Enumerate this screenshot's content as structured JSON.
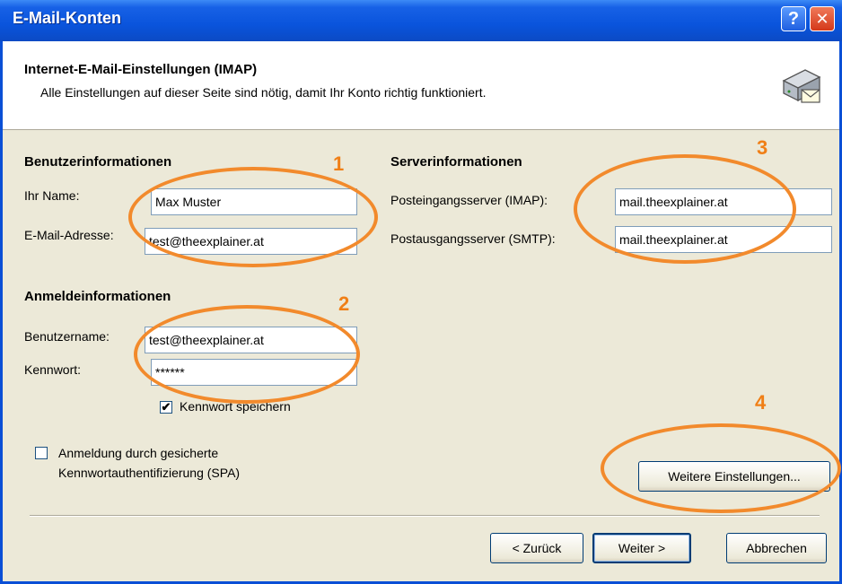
{
  "window": {
    "title": "E-Mail-Konten",
    "help_glyph": "?",
    "close_glyph": "✕"
  },
  "header": {
    "title": "Internet-E-Mail-Einstellungen (IMAP)",
    "subtitle": "Alle Einstellungen auf dieser Seite sind nötig, damit Ihr Konto richtig funktioniert.",
    "icon": "mail-server-icon"
  },
  "user_info": {
    "heading": "Benutzerinformationen",
    "name_label": "Ihr Name:",
    "name_value": "Max Muster",
    "email_label": "E-Mail-Adresse:",
    "email_value": "test@theexplainer.at"
  },
  "server_info": {
    "heading": "Serverinformationen",
    "incoming_label": "Posteingangsserver (IMAP):",
    "incoming_value": "mail.theexplainer.at",
    "outgoing_label": "Postausgangsserver (SMTP):",
    "outgoing_value": "mail.theexplainer.at"
  },
  "login_info": {
    "heading": "Anmeldeinformationen",
    "username_label": "Benutzername:",
    "username_value": "test@theexplainer.at",
    "password_label": "Kennwort:",
    "password_value": "******",
    "save_password_label": "Kennwort speichern",
    "save_password_checked": true
  },
  "spa": {
    "line1": "Anmeldung durch gesicherte",
    "line2": "Kennwortauthentifizierung (SPA)",
    "checked": false
  },
  "more_settings_label": "Weitere Einstellungen...",
  "footer": {
    "back_label": "< Zurück",
    "next_label": "Weiter >",
    "cancel_label": "Abbrechen"
  },
  "annotations": {
    "n1": "1",
    "n2": "2",
    "n3": "3",
    "n4": "4",
    "color": "#f28a2c"
  }
}
